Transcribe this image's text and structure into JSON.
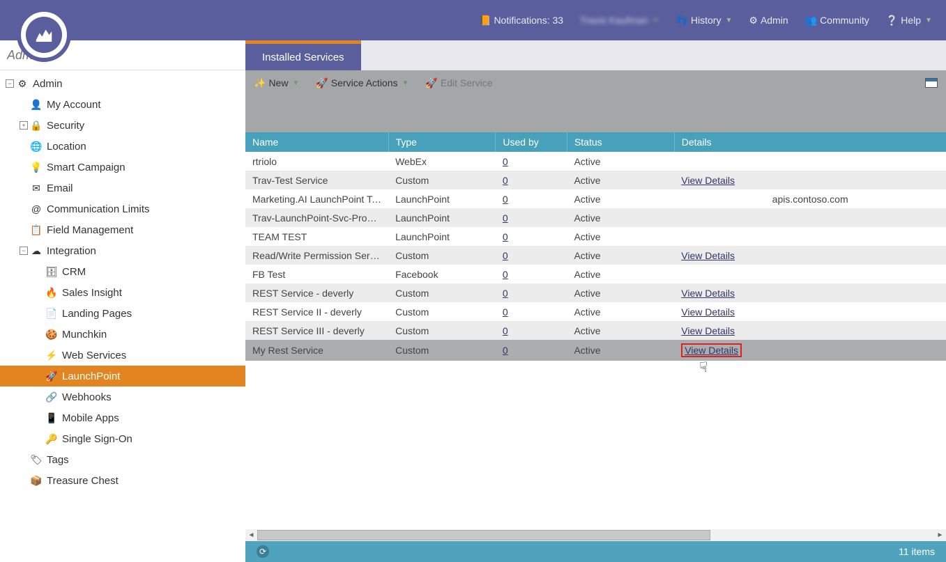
{
  "topbar": {
    "notifications_label": "Notifications: 33",
    "user_name": "Travis Kaufman",
    "history_label": "History",
    "admin_label": "Admin",
    "community_label": "Community",
    "help_label": "Help"
  },
  "search": {
    "placeholder": "Admin..."
  },
  "tree": [
    {
      "level": 0,
      "toggle": "−",
      "icon": "⚙",
      "label": "Admin",
      "name": "admin"
    },
    {
      "level": 1,
      "toggle": "",
      "icon": "👤",
      "label": "My Account",
      "name": "my-account"
    },
    {
      "level": 1,
      "toggle": "+",
      "icon": "🔒",
      "label": "Security",
      "name": "security"
    },
    {
      "level": 1,
      "toggle": "",
      "icon": "🌐",
      "label": "Location",
      "name": "location"
    },
    {
      "level": 1,
      "toggle": "",
      "icon": "💡",
      "label": "Smart Campaign",
      "name": "smart-campaign"
    },
    {
      "level": 1,
      "toggle": "",
      "icon": "✉",
      "label": "Email",
      "name": "email"
    },
    {
      "level": 1,
      "toggle": "",
      "icon": "@",
      "label": "Communication Limits",
      "name": "communication-limits"
    },
    {
      "level": 1,
      "toggle": "",
      "icon": "📋",
      "label": "Field Management",
      "name": "field-management"
    },
    {
      "level": 1,
      "toggle": "−",
      "icon": "☁",
      "label": "Integration",
      "name": "integration"
    },
    {
      "level": 2,
      "toggle": "",
      "icon": "🗄",
      "label": "CRM",
      "name": "crm"
    },
    {
      "level": 2,
      "toggle": "",
      "icon": "🔥",
      "label": "Sales Insight",
      "name": "sales-insight"
    },
    {
      "level": 2,
      "toggle": "",
      "icon": "📄",
      "label": "Landing Pages",
      "name": "landing-pages"
    },
    {
      "level": 2,
      "toggle": "",
      "icon": "🍪",
      "label": "Munchkin",
      "name": "munchkin"
    },
    {
      "level": 2,
      "toggle": "",
      "icon": "⚡",
      "label": "Web Services",
      "name": "web-services"
    },
    {
      "level": 2,
      "toggle": "",
      "icon": "🚀",
      "label": "LaunchPoint",
      "name": "launchpoint",
      "selected": true
    },
    {
      "level": 2,
      "toggle": "",
      "icon": "🔗",
      "label": "Webhooks",
      "name": "webhooks"
    },
    {
      "level": 2,
      "toggle": "",
      "icon": "📱",
      "label": "Mobile Apps",
      "name": "mobile-apps"
    },
    {
      "level": 2,
      "toggle": "",
      "icon": "🔑",
      "label": "Single Sign-On",
      "name": "single-sign-on"
    },
    {
      "level": 1,
      "toggle": "",
      "icon": "🏷",
      "label": "Tags",
      "name": "tags"
    },
    {
      "level": 1,
      "toggle": "",
      "icon": "📦",
      "label": "Treasure Chest",
      "name": "treasure-chest"
    }
  ],
  "tab": {
    "title": "Installed Services"
  },
  "toolbar": {
    "new_label": "New",
    "service_actions_label": "Service Actions",
    "edit_service_label": "Edit Service"
  },
  "grid": {
    "columns": [
      "Name",
      "Type",
      "Used by",
      "Status",
      "Details"
    ],
    "rows": [
      {
        "name": "rtriolo",
        "type": "WebEx",
        "used": "0",
        "status": "Active",
        "details": ""
      },
      {
        "name": "Trav-Test Service",
        "type": "Custom",
        "used": "0",
        "status": "Active",
        "details": "View Details"
      },
      {
        "name": "Marketing.AI LaunchPoint Te…",
        "type": "LaunchPoint",
        "used": "0",
        "status": "Active",
        "details": "apis.contoso.com"
      },
      {
        "name": "Trav-LaunchPoint-Svc-Prog-I…",
        "type": "LaunchPoint",
        "used": "0",
        "status": "Active",
        "details": ""
      },
      {
        "name": "TEAM TEST",
        "type": "LaunchPoint",
        "used": "0",
        "status": "Active",
        "details": ""
      },
      {
        "name": "Read/Write Permission Servi…",
        "type": "Custom",
        "used": "0",
        "status": "Active",
        "details": "View Details"
      },
      {
        "name": "FB Test",
        "type": "Facebook",
        "used": "0",
        "status": "Active",
        "details": ""
      },
      {
        "name": "REST Service - deverly",
        "type": "Custom",
        "used": "0",
        "status": "Active",
        "details": "View Details"
      },
      {
        "name": "REST Service II - deverly",
        "type": "Custom",
        "used": "0",
        "status": "Active",
        "details": "View Details"
      },
      {
        "name": "REST Service III - deverly",
        "type": "Custom",
        "used": "0",
        "status": "Active",
        "details": "View Details"
      },
      {
        "name": "My Rest Service",
        "type": "Custom",
        "used": "0",
        "status": "Active",
        "details": "View Details",
        "selected": true,
        "highlight": true
      }
    ],
    "col_widths": [
      "200",
      "150",
      "100",
      "150",
      "380"
    ]
  },
  "status": {
    "items_label": "11 items"
  }
}
